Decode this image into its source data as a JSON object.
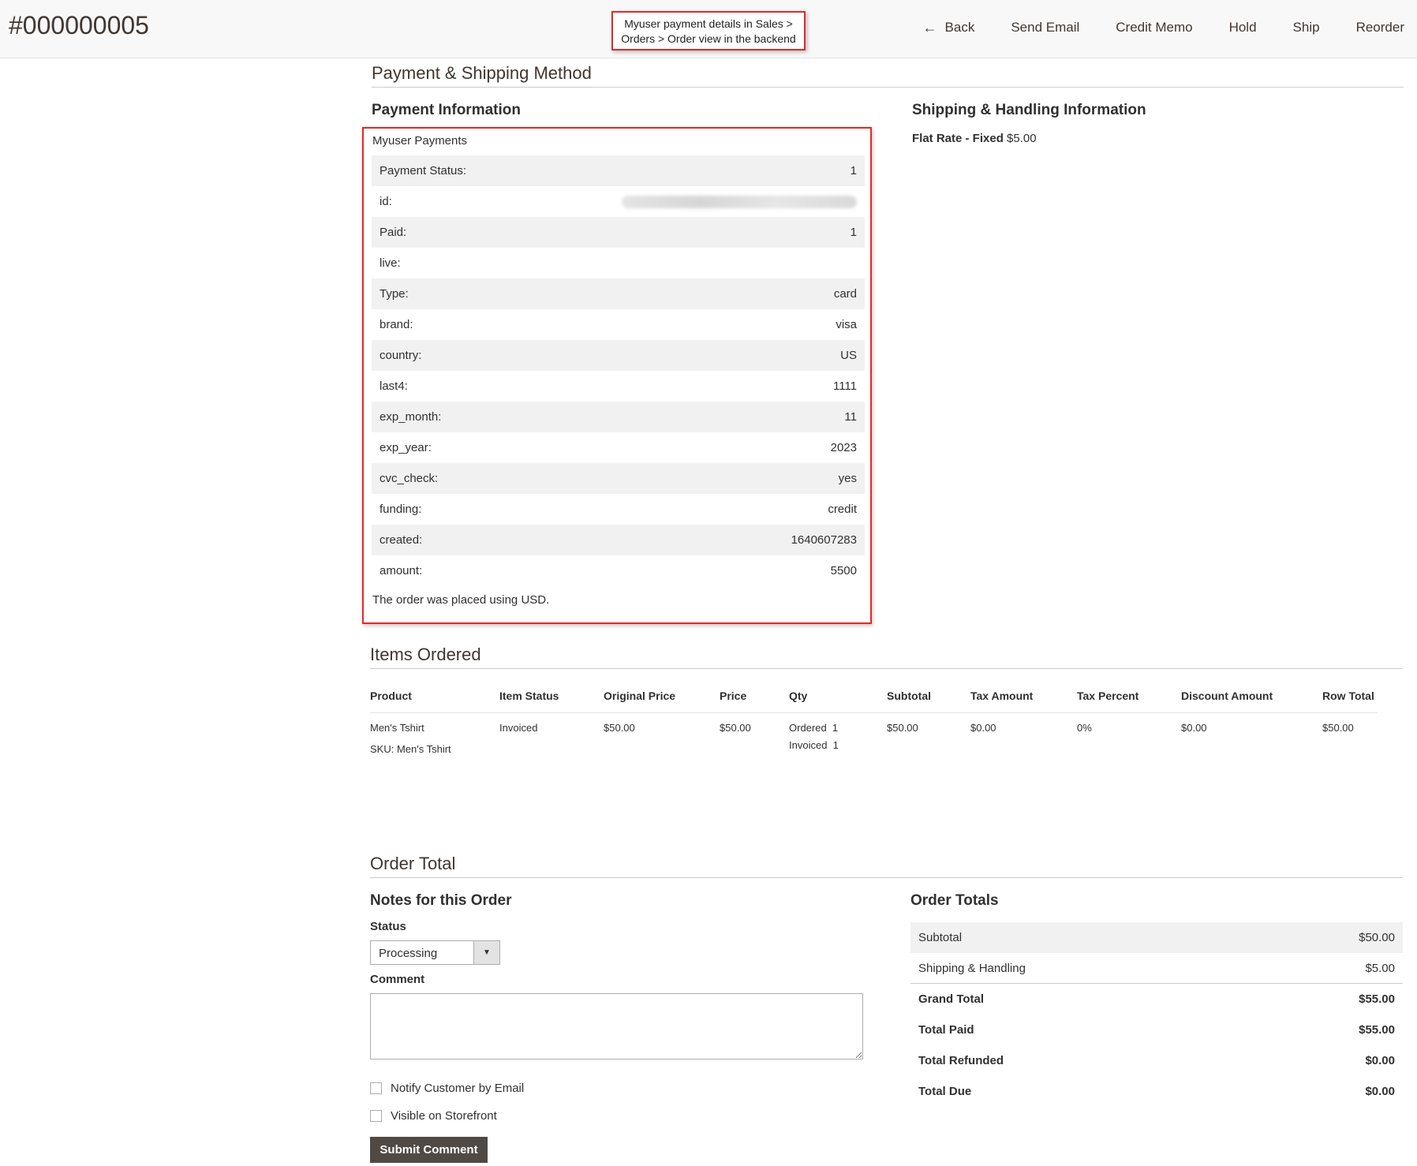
{
  "header": {
    "order_number": "#000000005",
    "callout_line1": "Myuser payment details in Sales >",
    "callout_line2": "Orders > Order view in the backend",
    "actions": {
      "back": "Back",
      "send_email": "Send Email",
      "credit_memo": "Credit Memo",
      "hold": "Hold",
      "ship": "Ship",
      "reorder": "Reorder"
    }
  },
  "payment_shipping": {
    "title": "Payment & Shipping Method",
    "payment_info_title": "Payment Information",
    "method_name": "Myuser Payments",
    "rows": [
      {
        "label": "Payment Status:",
        "value": "1"
      },
      {
        "label": "id:",
        "value": ""
      },
      {
        "label": "Paid:",
        "value": "1"
      },
      {
        "label": "live:",
        "value": ""
      },
      {
        "label": "Type:",
        "value": "card"
      },
      {
        "label": "brand:",
        "value": "visa"
      },
      {
        "label": "country:",
        "value": "US"
      },
      {
        "label": "last4:",
        "value": "1111"
      },
      {
        "label": "exp_month:",
        "value": "11"
      },
      {
        "label": "exp_year:",
        "value": "2023"
      },
      {
        "label": "cvc_check:",
        "value": "yes"
      },
      {
        "label": "funding:",
        "value": "credit"
      },
      {
        "label": "created:",
        "value": "1640607283"
      },
      {
        "label": "amount:",
        "value": "5500"
      }
    ],
    "currency_note": "The order was placed using USD.",
    "shipping_title": "Shipping & Handling Information",
    "shipping_method": "Flat Rate - Fixed",
    "shipping_price": "$5.00"
  },
  "items": {
    "title": "Items Ordered",
    "columns": [
      "Product",
      "Item Status",
      "Original Price",
      "Price",
      "Qty",
      "Subtotal",
      "Tax Amount",
      "Tax Percent",
      "Discount Amount",
      "Row Total"
    ],
    "row": {
      "product": "Men's Tshirt",
      "sku": "SKU: Men's Tshirt",
      "status": "Invoiced",
      "original_price": "$50.00",
      "price": "$50.00",
      "qty_ordered": "Ordered  1",
      "qty_invoiced": "Invoiced  1",
      "subtotal": "$50.00",
      "tax_amount": "$0.00",
      "tax_percent": "0%",
      "discount": "$0.00",
      "row_total": "$50.00"
    }
  },
  "order_total": {
    "title": "Order Total",
    "notes_title": "Notes for this Order",
    "status_label": "Status",
    "status_value": "Processing",
    "comment_label": "Comment",
    "notify_label": "Notify Customer by Email",
    "visible_label": "Visible on Storefront",
    "submit_label": "Submit Comment",
    "totals_title": "Order Totals",
    "totals": [
      {
        "label": "Subtotal",
        "value": "$50.00"
      },
      {
        "label": "Shipping & Handling",
        "value": "$5.00"
      },
      {
        "label": "Grand Total",
        "value": "$55.00"
      },
      {
        "label": "Total Paid",
        "value": "$55.00"
      },
      {
        "label": "Total Refunded",
        "value": "$0.00"
      },
      {
        "label": "Total Due",
        "value": "$0.00"
      }
    ]
  }
}
